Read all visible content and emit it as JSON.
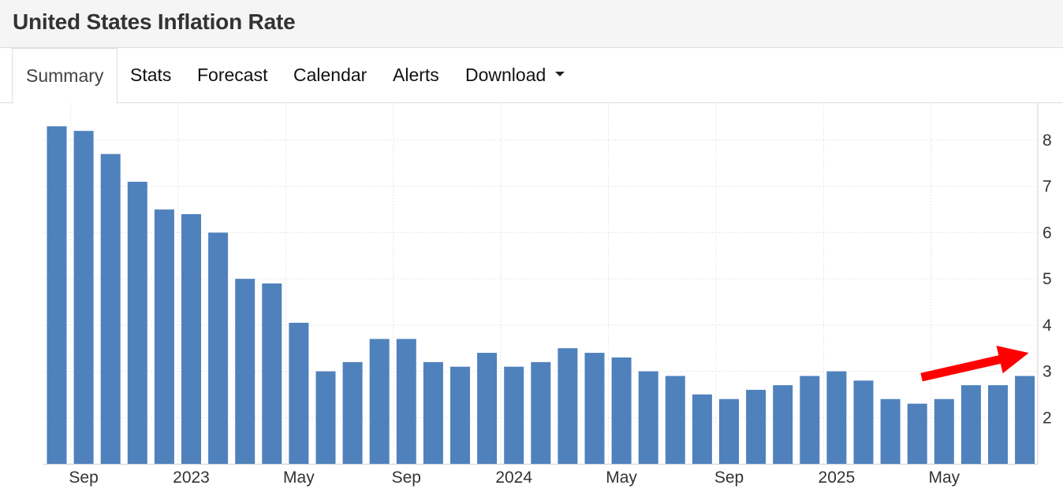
{
  "header": {
    "title": "United States Inflation Rate"
  },
  "tabs": [
    {
      "label": "Summary",
      "active": true
    },
    {
      "label": "Stats"
    },
    {
      "label": "Forecast"
    },
    {
      "label": "Calendar"
    },
    {
      "label": "Alerts"
    },
    {
      "label": "Download",
      "has_dropdown": true
    }
  ],
  "chart_data": {
    "type": "bar",
    "title": "",
    "xlabel": "",
    "ylabel": "",
    "x": [
      "2022-08",
      "2022-09",
      "2022-10",
      "2022-11",
      "2022-12",
      "2023-01",
      "2023-02",
      "2023-03",
      "2023-04",
      "2023-05",
      "2023-06",
      "2023-07",
      "2023-08",
      "2023-09",
      "2023-10",
      "2023-11",
      "2023-12",
      "2024-01",
      "2024-02",
      "2024-03",
      "2024-04",
      "2024-05",
      "2024-06",
      "2024-07",
      "2024-08",
      "2024-09",
      "2024-10",
      "2024-11",
      "2024-12",
      "2025-01",
      "2025-02",
      "2025-03",
      "2025-04",
      "2025-05",
      "2025-06",
      "2025-07",
      "2025-08"
    ],
    "values": [
      8.3,
      8.2,
      7.7,
      7.1,
      6.5,
      6.4,
      6.0,
      5.0,
      4.9,
      4.05,
      3.0,
      3.2,
      3.7,
      3.7,
      3.2,
      3.1,
      3.4,
      3.1,
      3.2,
      3.5,
      3.4,
      3.3,
      3.0,
      2.9,
      2.5,
      2.4,
      2.6,
      2.7,
      2.9,
      3.0,
      2.8,
      2.4,
      2.3,
      2.4,
      2.7,
      2.7,
      2.9
    ],
    "ylim": [
      1.0,
      8.8
    ],
    "yticks": [
      2,
      3,
      4,
      5,
      6,
      7,
      8
    ],
    "xticks": [
      {
        "at": "2022-09",
        "label": "Sep"
      },
      {
        "at": "2023-01",
        "label": "2023"
      },
      {
        "at": "2023-05",
        "label": "May"
      },
      {
        "at": "2023-09",
        "label": "Sep"
      },
      {
        "at": "2024-01",
        "label": "2024"
      },
      {
        "at": "2024-05",
        "label": "May"
      },
      {
        "at": "2024-09",
        "label": "Sep"
      },
      {
        "at": "2025-01",
        "label": "2025"
      },
      {
        "at": "2025-05",
        "label": "May"
      }
    ],
    "grid": true,
    "y_axis_side": "right",
    "bar_color": "#4f81bd",
    "annotation": {
      "type": "arrow",
      "color": "#ff0000",
      "direction": "up-right",
      "near": "last bar"
    }
  }
}
